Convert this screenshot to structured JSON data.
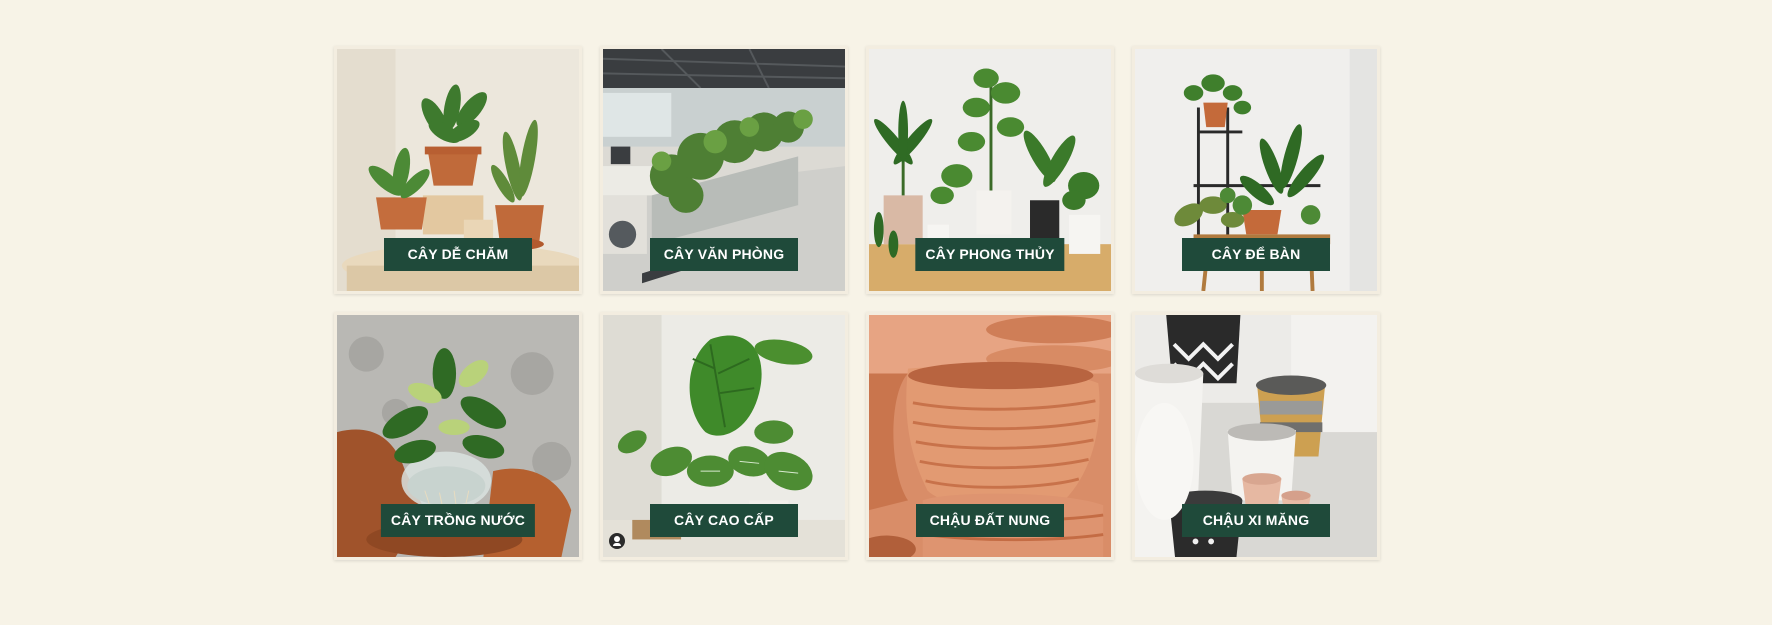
{
  "categories": [
    {
      "label": "CÂY DỄ CHĂM",
      "image": "potted plants on wooden table"
    },
    {
      "label": "CÂY VĂN PHÒNG",
      "image": "office with planter dividers"
    },
    {
      "label": "CÂY PHONG THỦY",
      "image": "feng shui floor plants"
    },
    {
      "label": "CÂY ĐỂ BÀN",
      "image": "plants on metal plant stand"
    },
    {
      "label": "CÂY TRỒNG NƯỚC",
      "image": "hydroponic plant in glass bowl"
    },
    {
      "label": "CÂY CAO CẤP",
      "image": "premium philodendron plant"
    },
    {
      "label": "CHẬU ĐẤT NUNG",
      "image": "terracotta clay pots"
    },
    {
      "label": "CHẬU XI MĂNG",
      "image": "cement pots"
    }
  ],
  "colors": {
    "background": "#f7f3e7",
    "label_background": "#1f4a3a",
    "label_text": "#ffffff"
  }
}
